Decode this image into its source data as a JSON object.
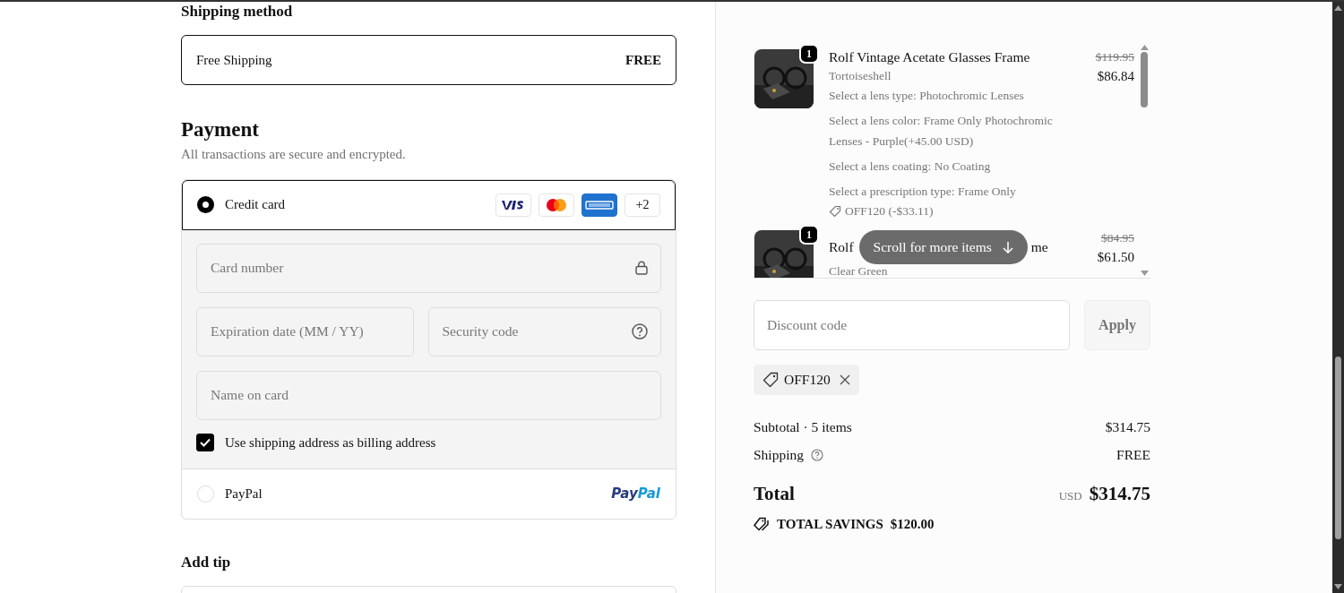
{
  "shipping_method": {
    "heading": "Shipping method",
    "option": {
      "label": "Free Shipping",
      "price": "FREE",
      "selected": true
    }
  },
  "payment": {
    "heading": "Payment",
    "subtitle": "All transactions are secure and encrypted.",
    "methods": [
      {
        "kind": "card",
        "label": "Credit card",
        "selected": true,
        "brands": [
          {
            "kind": "visa"
          },
          {
            "kind": "mastercard"
          },
          {
            "kind": "amex"
          },
          {
            "kind": "more",
            "label": "+2"
          }
        ],
        "fields": [
          {
            "kind": "card_number",
            "placeholder": "Card number"
          },
          {
            "kind": "expiry",
            "placeholder": "Expiration date (MM / YY)"
          },
          {
            "kind": "security_code",
            "placeholder": "Security code"
          },
          {
            "kind": "name",
            "placeholder": "Name on card"
          }
        ],
        "billing_checkbox": {
          "label": "Use shipping address as billing address",
          "checked": true
        }
      },
      {
        "kind": "paypal",
        "label": "PayPal",
        "selected": false,
        "logo": [
          "Pay",
          "Pal"
        ]
      }
    ]
  },
  "tip": {
    "heading": "Add tip"
  },
  "cart": {
    "items": [
      {
        "quantity": "1",
        "title_parts": [
          "Rolf Vintage Acetate Glasses Frame"
        ],
        "variant": "Tortoiseshell",
        "options": [
          "Select a lens type: Photochromic Lenses",
          "Select a lens color: Frame Only Photochromic Lenses - Purple(+45.00 USD)",
          "Select a lens coating: No Coating",
          "Select a prescription type: Frame Only"
        ],
        "discount": "OFF120 (-$33.11)",
        "original_price": "$119.95",
        "price": "$86.84"
      },
      {
        "quantity": "1",
        "title_parts": [
          "Rolf",
          "me"
        ],
        "variant": "Clear Green",
        "original_price": "$84.95",
        "price": "$61.50"
      }
    ],
    "scroll_hint": "Scroll for more items",
    "discount_field": {
      "placeholder": "Discount code"
    },
    "apply_button": "Apply",
    "applied_codes": [
      "OFF120"
    ],
    "summary": [
      {
        "label": "Subtotal · 5 items",
        "value": "$314.75"
      },
      {
        "label": "Shipping",
        "value": "FREE",
        "help": true
      }
    ],
    "total": {
      "label": "Total",
      "currency": "USD",
      "value": "$314.75"
    },
    "savings": {
      "label": "TOTAL SAVINGS",
      "value": "$120.00"
    }
  }
}
